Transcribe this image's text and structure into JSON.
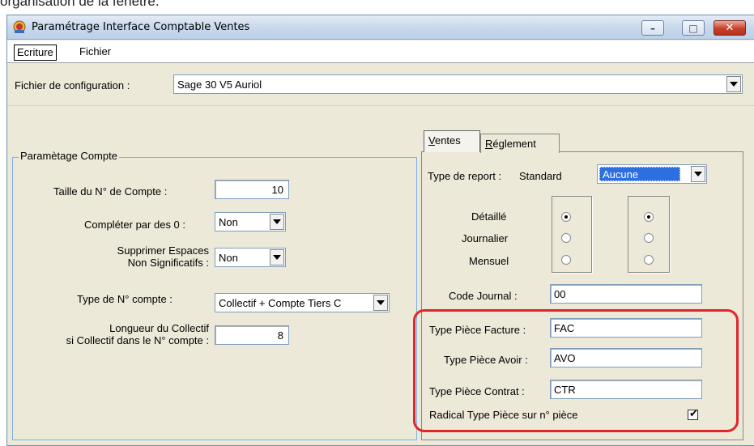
{
  "caption": "organisation de la fenêtre.",
  "window": {
    "title": "Paramétrage Interface Comptable Ventes",
    "controls": {
      "minimize": "–",
      "maximize": "□",
      "close": "✕"
    }
  },
  "menubar": {
    "items": [
      {
        "label": "Ecriture"
      },
      {
        "label": "Fichier"
      }
    ]
  },
  "config": {
    "label": "Fichier de configuration :",
    "value": "Sage 30 V5 Auriol"
  },
  "account_group": {
    "title": "Paramètage Compte",
    "account_size_label": "Taille du N° de Compte :",
    "account_size_value": "10",
    "pad_zero_label": "Compléter par des 0 :",
    "pad_zero_value": "Non",
    "remove_spaces_label_1": "Supprimer Espaces",
    "remove_spaces_label_2": "Non Significatifs :",
    "remove_spaces_value": "Non",
    "account_type_label": "Type de N° compte :",
    "account_type_value": "Collectif + Compte Tiers C",
    "collectif_length_label_1": "Longueur du Collectif",
    "collectif_length_label_2": "si Collectif dans le N° compte :",
    "collectif_length_value": "8"
  },
  "tabs": {
    "ventes": {
      "prefix": "",
      "mnemonic": "V",
      "rest": "entes"
    },
    "reglement": {
      "prefix": "",
      "mnemonic": "R",
      "rest": "églement"
    }
  },
  "ventes": {
    "report_type_label": "Type de report :",
    "report_type_value": "Standard",
    "report_select_value": "Aucune",
    "detail_label": "Détaillé",
    "journalier_label": "Journalier",
    "mensuel_label": "Mensuel",
    "radio_col1_selected": "Détaillé",
    "radio_col2_selected": "Détaillé",
    "code_journal_label": "Code Journal :",
    "code_journal_value": "00",
    "facture_label": "Type Pièce Facture :",
    "facture_value": "FAC",
    "avoir_label": "Type Pièce Avoir :",
    "avoir_value": "AVO",
    "contrat_label": "Type Pièce Contrat :",
    "contrat_value": "CTR",
    "radical_label": "Radical Type Pièce sur n° pièce",
    "radical_checked": true
  },
  "colors": {
    "highlight": "#e0262a",
    "selection": "#2d6ee0",
    "group_border": "#7fb0e0"
  }
}
